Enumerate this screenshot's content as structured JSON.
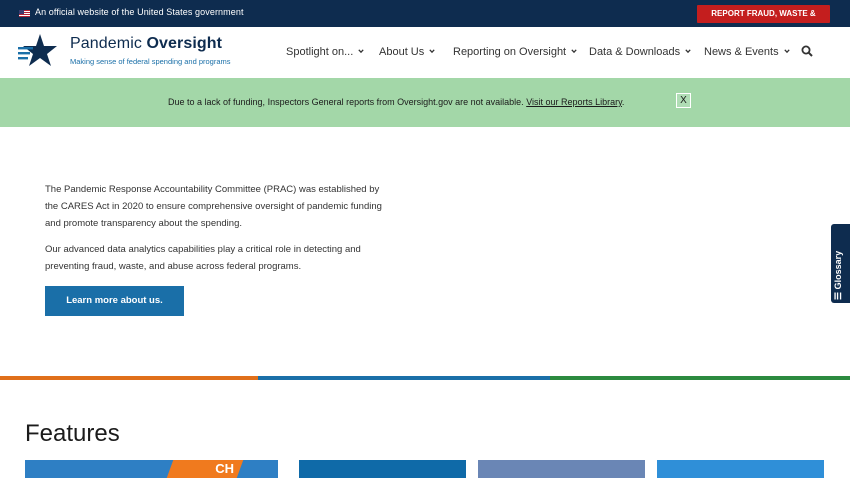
{
  "gov_banner": {
    "text": "An official website of the United States government",
    "report_button": "REPORT FRAUD, WASTE & ABUSE"
  },
  "header": {
    "logo_title_prefix": "Pandemic ",
    "logo_title_emphasis": "Oversight",
    "logo_subtitle": "Making sense of federal spending and programs",
    "nav": [
      {
        "label": "Spotlight on..."
      },
      {
        "label": "About Us"
      },
      {
        "label": "Reporting on Oversight"
      },
      {
        "label": "Data & Downloads"
      },
      {
        "label": "News & Events"
      }
    ]
  },
  "notice": {
    "text": "Due to a lack of funding, Inspectors General reports from Oversight.gov are not available.",
    "link": "Visit our Reports Library",
    "close": "X"
  },
  "hero": {
    "paragraph1": "The Pandemic Response Accountability Committee (PRAC) was established by the CARES Act in 2020 to ensure comprehensive oversight of pandemic funding and promote transparency about the spending.",
    "paragraph2": "Our advanced data analytics capabilities play a critical role in detecting and preventing fraud, waste, and abuse across federal programs.",
    "button": "Learn more about us."
  },
  "glossary": {
    "label": "Glossary"
  },
  "divider_colors": [
    "#e06f1a",
    "#1a6fa8",
    "#2c8a3f"
  ],
  "features": {
    "title": "Features",
    "card1_text": "CH"
  },
  "colors": {
    "navy": "#0e2c4f",
    "accent_blue": "#1a6fa8",
    "report_red": "#c41e1e",
    "notice_green": "#a3d7a8"
  }
}
